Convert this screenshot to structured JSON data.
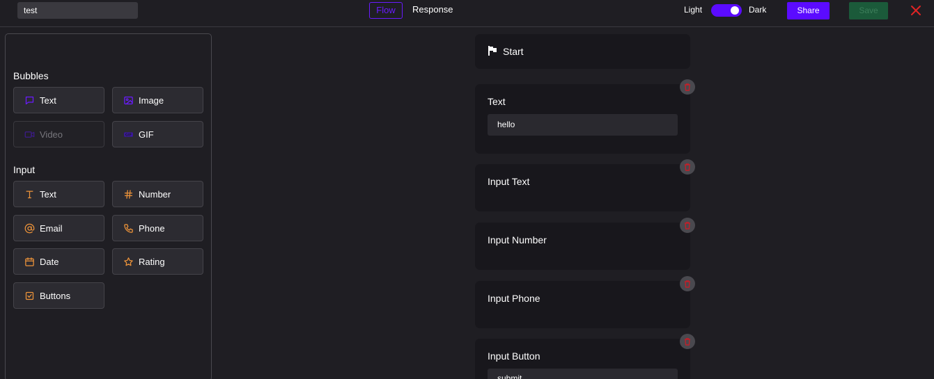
{
  "header": {
    "title_value": "test",
    "tabs": [
      {
        "label": "Flow",
        "active": true
      },
      {
        "label": "Response",
        "active": false
      }
    ],
    "theme": {
      "light_label": "Light",
      "dark_label": "Dark",
      "is_dark": true
    },
    "share_label": "Share",
    "save_label": "Save"
  },
  "sidebar": {
    "bubbles_title": "Bubbles",
    "bubbles": [
      {
        "label": "Text",
        "icon": "message-square-icon",
        "enabled": true
      },
      {
        "label": "Image",
        "icon": "image-icon",
        "enabled": true
      },
      {
        "label": "Video",
        "icon": "video-icon",
        "enabled": false
      },
      {
        "label": "GIF",
        "icon": "gif-icon",
        "enabled": true
      }
    ],
    "input_title": "Input",
    "inputs": [
      {
        "label": "Text",
        "icon": "type-icon"
      },
      {
        "label": "Number",
        "icon": "hash-icon"
      },
      {
        "label": "Email",
        "icon": "at-sign-icon"
      },
      {
        "label": "Phone",
        "icon": "phone-icon"
      },
      {
        "label": "Date",
        "icon": "calendar-icon"
      },
      {
        "label": "Rating",
        "icon": "star-icon"
      },
      {
        "label": "Buttons",
        "icon": "check-square-icon"
      }
    ]
  },
  "flow": {
    "start_label": "Start",
    "blocks": [
      {
        "title": "Text",
        "value": "hello"
      },
      {
        "title": "Input Text"
      },
      {
        "title": "Input Number"
      },
      {
        "title": "Input Phone"
      },
      {
        "title": "Input Button",
        "value": "submit"
      }
    ]
  },
  "colors": {
    "accent": "#5b0bff",
    "save": "#1b5a3a",
    "close": "#e02424",
    "icon_bubble": "#6a1bff",
    "icon_input": "#f0953a"
  }
}
